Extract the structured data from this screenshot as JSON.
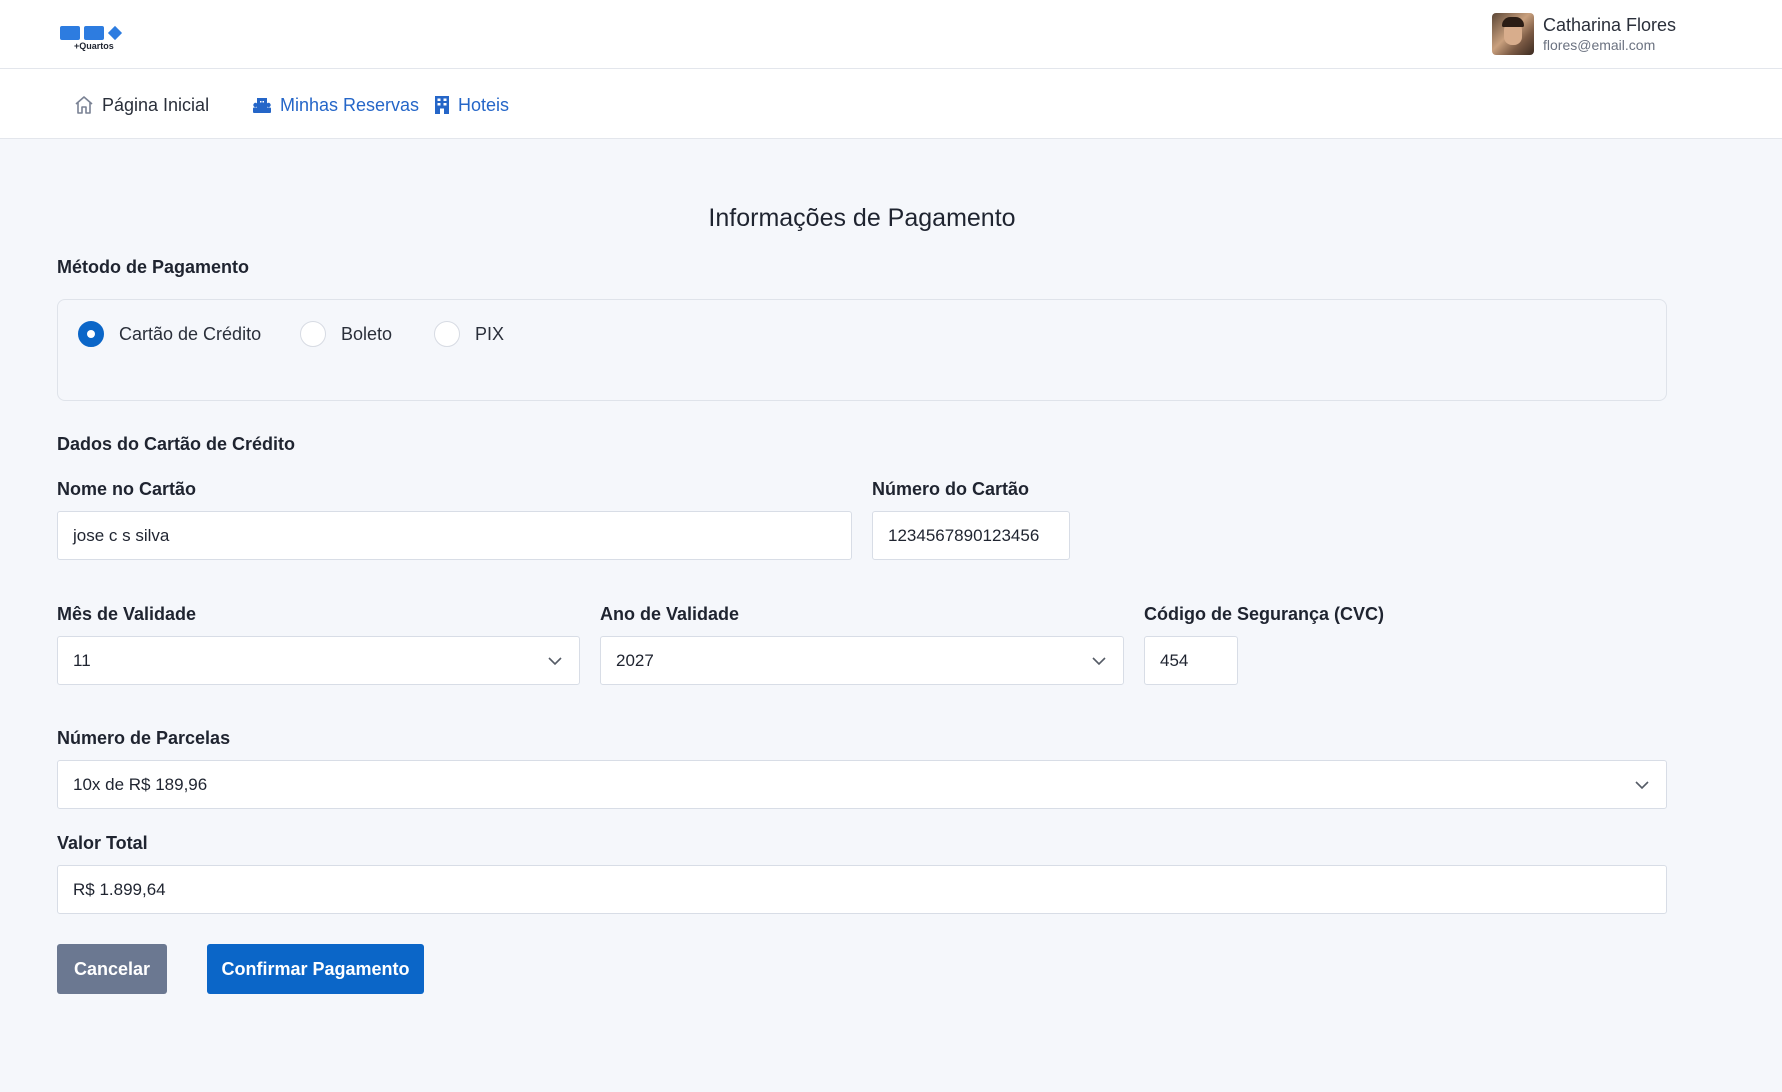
{
  "header": {
    "logo_text": "+Quartos",
    "user": {
      "name": "Catharina Flores",
      "email": "flores@email.com"
    }
  },
  "nav": {
    "home": "Página Inicial",
    "reservations": "Minhas Reservas",
    "hotels": "Hoteis"
  },
  "colors": {
    "primary": "#0b66c8",
    "link": "#2566c8",
    "secondary": "#6b7891"
  },
  "page": {
    "title": "Informações de Pagamento",
    "payment_method_label": "Método de Pagamento",
    "payment_methods": [
      {
        "label": "Cartão de Crédito",
        "selected": true
      },
      {
        "label": "Boleto",
        "selected": false
      },
      {
        "label": "PIX",
        "selected": false
      }
    ],
    "card_section_label": "Dados do Cartão de Crédito",
    "card_name": {
      "label": "Nome no Cartão",
      "value": "jose c s silva"
    },
    "card_number": {
      "label": "Número do Cartão",
      "value": "1234567890123456"
    },
    "exp_month": {
      "label": "Mês de Validade",
      "value": "11"
    },
    "exp_year": {
      "label": "Ano de Validade",
      "value": "2027"
    },
    "cvc": {
      "label": "Código de Segurança (CVC)",
      "value": "454"
    },
    "installments": {
      "label": "Número de Parcelas",
      "value": "10x de R$ 189,96"
    },
    "total": {
      "label": "Valor Total",
      "value": "R$ 1.899,64"
    },
    "buttons": {
      "cancel": "Cancelar",
      "confirm": "Confirmar Pagamento"
    }
  }
}
